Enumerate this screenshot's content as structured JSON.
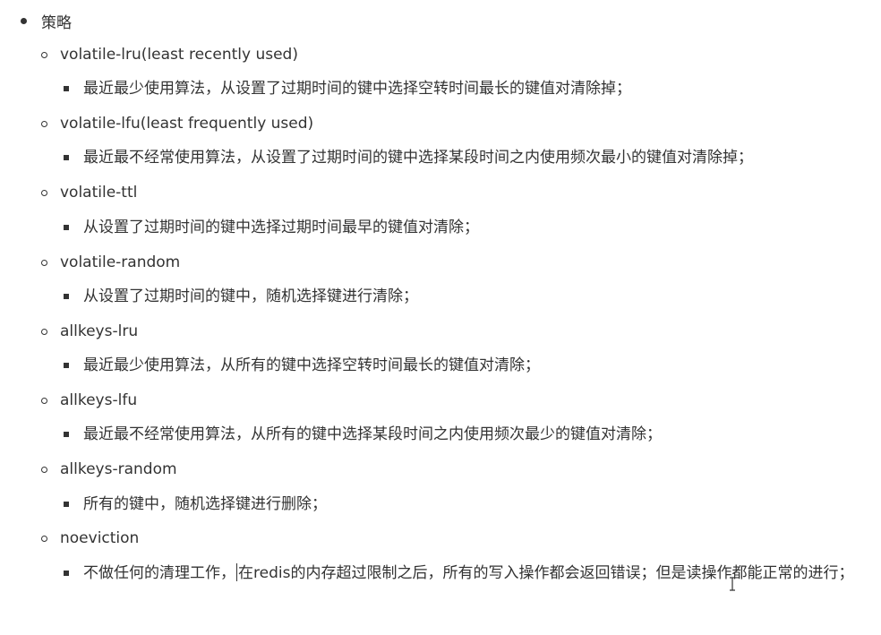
{
  "title": "策略",
  "policies": [
    {
      "name": "volatile-lru(least recently used)",
      "desc": "最近最少使用算法，从设置了过期时间的键中选择空转时间最长的键值对清除掉；"
    },
    {
      "name": "volatile-lfu(least frequently used)",
      "desc": "最近最不经常使用算法，从设置了过期时间的键中选择某段时间之内使用频次最小的键值对清除掉；"
    },
    {
      "name": "volatile-ttl",
      "desc": "从设置了过期时间的键中选择过期时间最早的键值对清除；"
    },
    {
      "name": "volatile-random",
      "desc": "从设置了过期时间的键中，随机选择键进行清除；"
    },
    {
      "name": "allkeys-lru",
      "desc": "最近最少使用算法，从所有的键中选择空转时间最长的键值对清除；"
    },
    {
      "name": "allkeys-lfu",
      "desc": "最近最不经常使用算法，从所有的键中选择某段时间之内使用频次最少的键值对清除；"
    },
    {
      "name": "allkeys-random",
      "desc": "所有的键中，随机选择键进行删除；"
    },
    {
      "name": "noeviction",
      "desc_before_caret": "不做任何的清理工作，",
      "desc_after_caret": "在redis的内存超过限制之后，所有的写入操作都会返回错误；但是读操作都能正常的进行；"
    }
  ]
}
